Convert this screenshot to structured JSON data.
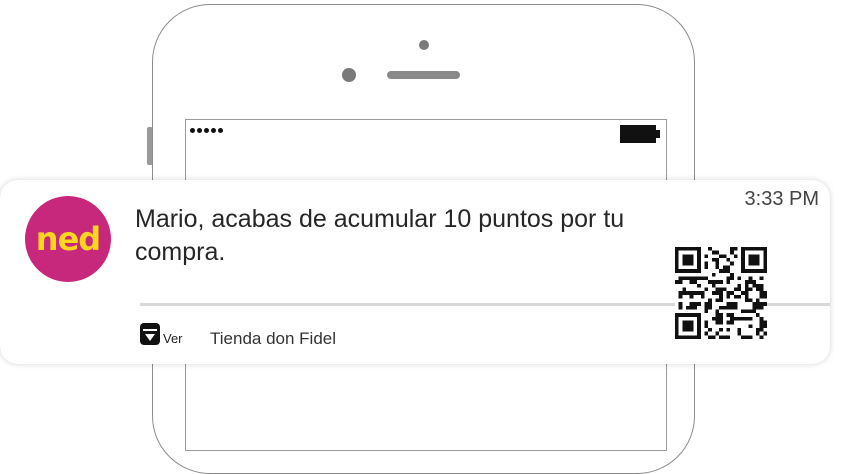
{
  "notification": {
    "app_logo_text": "ned",
    "message": "Mario, acabas de acumular 10 puntos por tu compra.",
    "time": "3:33 PM",
    "action_label": "Ver",
    "store_name": "Tienda don Fidel"
  },
  "colors": {
    "logo_background": "#c8287c",
    "logo_text": "#fdd41e"
  },
  "icons": {
    "action": "download-box-icon",
    "qr": "qr-code-icon",
    "battery": "battery-icon",
    "signal": "signal-dots-icon"
  }
}
